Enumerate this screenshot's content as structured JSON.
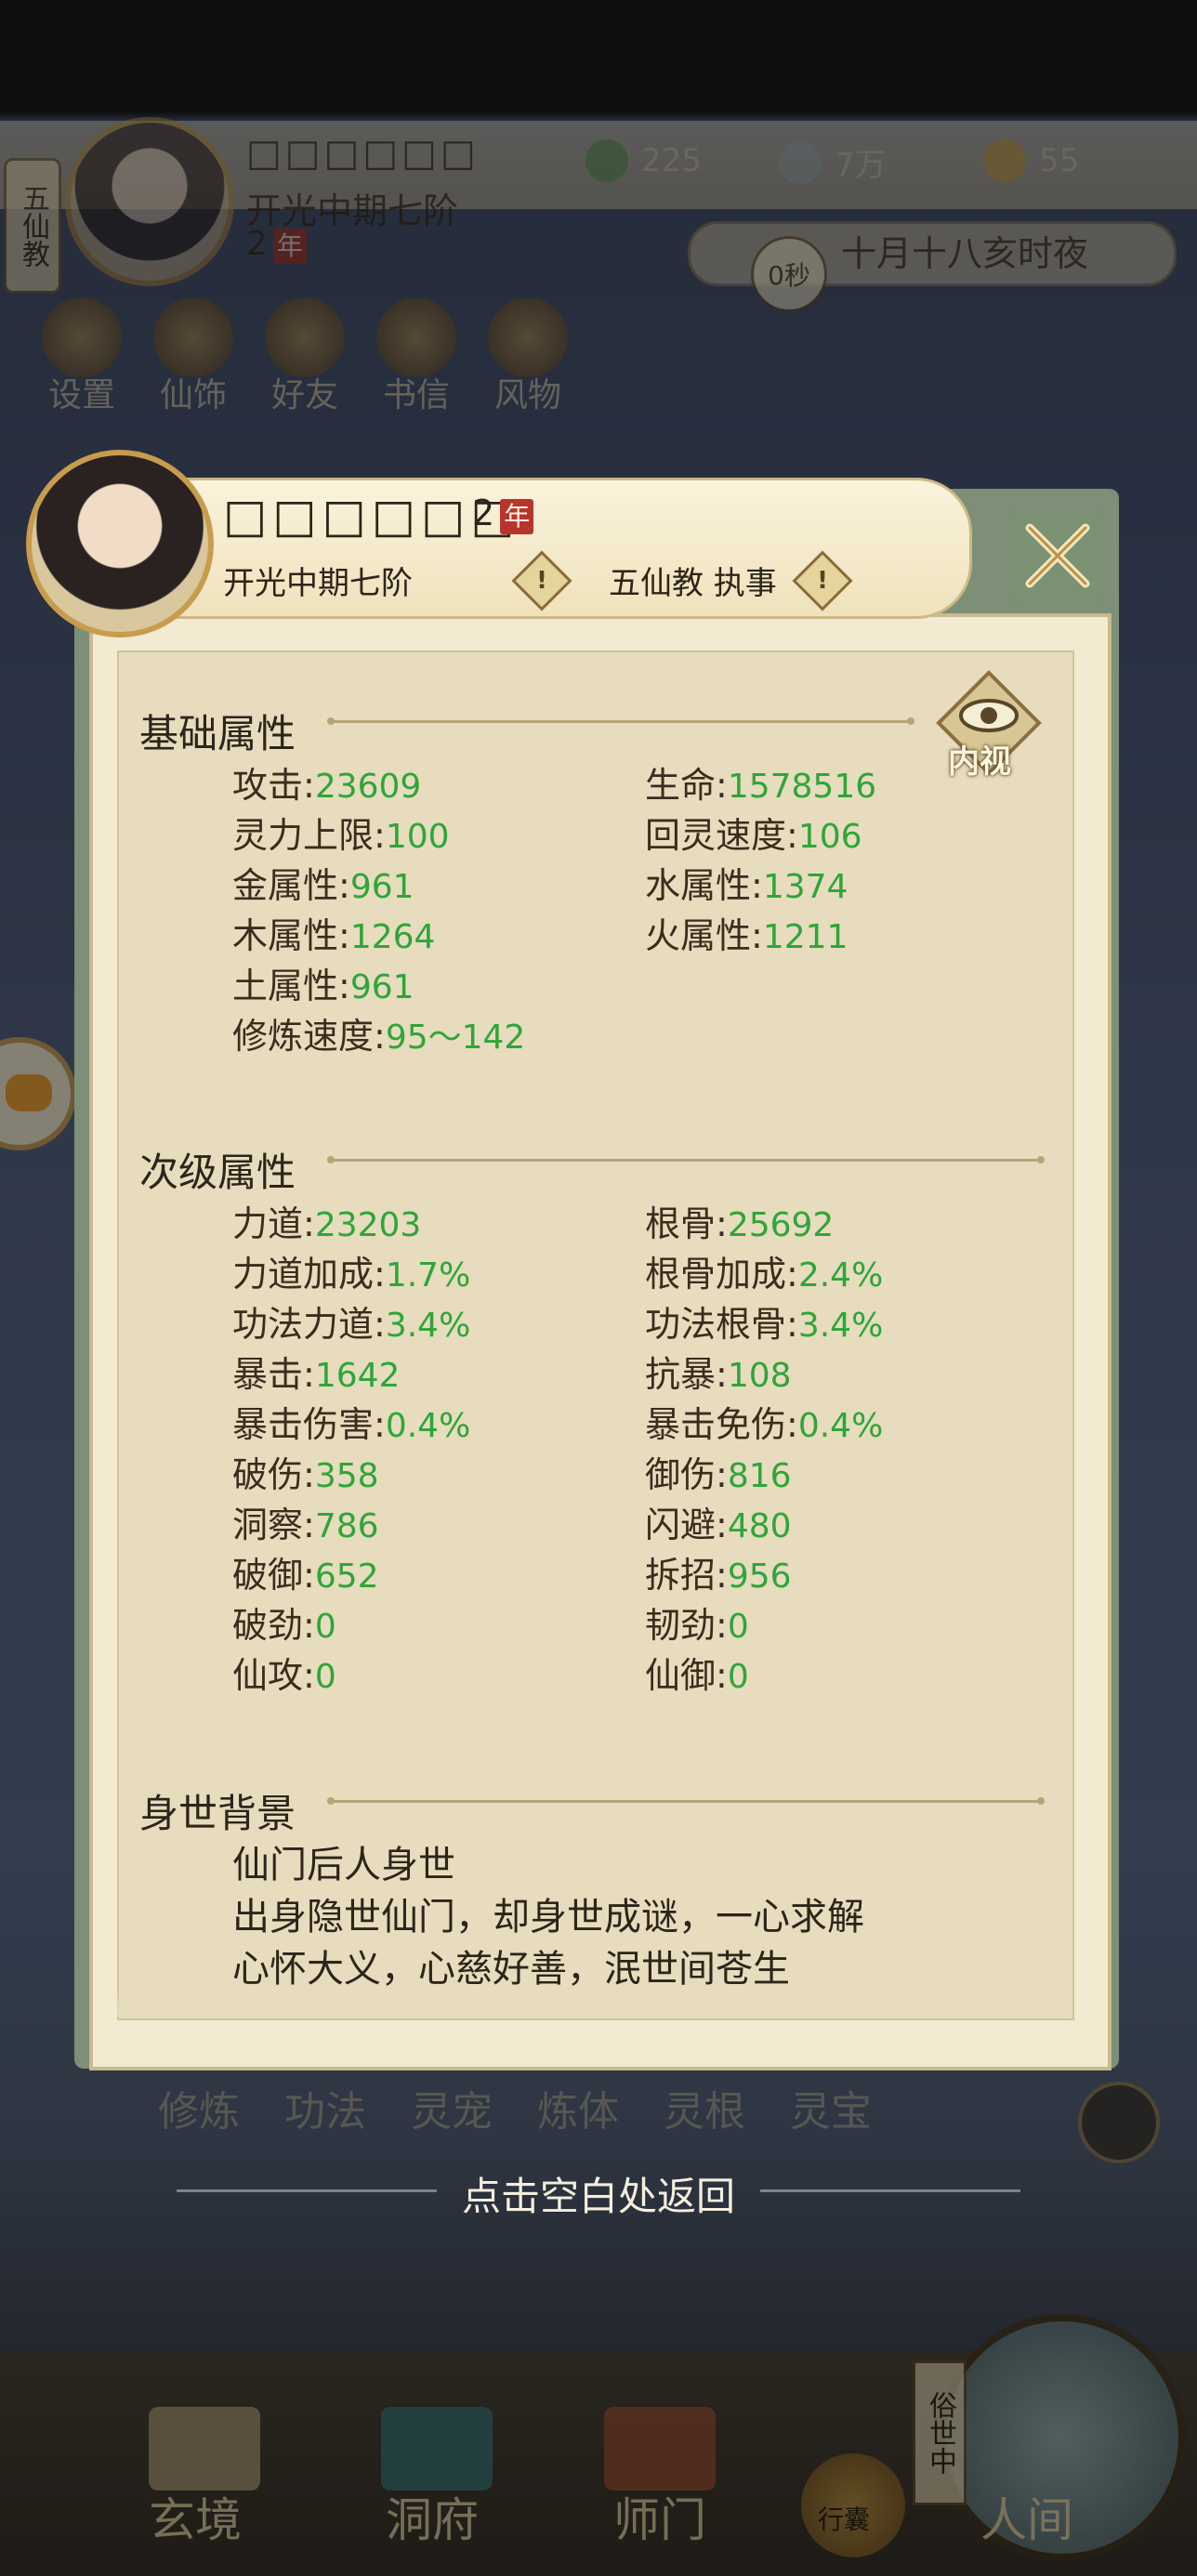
{
  "hud": {
    "sect_tag": "五仙教",
    "player_name": "□□□□□□",
    "realm": "开光中期七阶",
    "age": "2",
    "age_unit": "年",
    "resources": [
      {
        "icon": "spirit-leaf-icon",
        "value": "225"
      },
      {
        "icon": "coin-icon",
        "value": "7万"
      },
      {
        "icon": "gold-ingot-icon",
        "value": "55"
      }
    ],
    "timer_seconds": "0秒",
    "game_time": "十月十八亥时夜",
    "menu": [
      "设置",
      "仙饰",
      "好友",
      "书信",
      "风物"
    ]
  },
  "panel": {
    "name": "□□□□□□",
    "age": "2",
    "age_unit": "年",
    "realm": "开光中期七阶",
    "sect_position": "五仙教 执事",
    "info_mark": "!",
    "inner_view_label": "内视",
    "basic": {
      "title": "基础属性",
      "left": [
        {
          "label": "攻击:",
          "value": "23609"
        },
        {
          "label": "灵力上限:",
          "value": "100"
        },
        {
          "label": "金属性:",
          "value": "961"
        },
        {
          "label": "木属性:",
          "value": "1264"
        },
        {
          "label": "土属性:",
          "value": "961"
        },
        {
          "label": "修炼速度:",
          "value": "95～142"
        }
      ],
      "right": [
        {
          "label": "生命:",
          "value": "1578516"
        },
        {
          "label": "回灵速度:",
          "value": "106"
        },
        {
          "label": "水属性:",
          "value": "1374"
        },
        {
          "label": "火属性:",
          "value": "1211"
        }
      ]
    },
    "secondary": {
      "title": "次级属性",
      "left": [
        {
          "label": "力道:",
          "value": "23203"
        },
        {
          "label": "力道加成:",
          "value": "1.7%"
        },
        {
          "label": "功法力道:",
          "value": "3.4%"
        },
        {
          "label": "暴击:",
          "value": "1642"
        },
        {
          "label": "暴击伤害:",
          "value": "0.4%"
        },
        {
          "label": "破伤:",
          "value": "358"
        },
        {
          "label": "洞察:",
          "value": "786"
        },
        {
          "label": "破御:",
          "value": "652"
        },
        {
          "label": "破劲:",
          "value": "0"
        },
        {
          "label": "仙攻:",
          "value": "0"
        }
      ],
      "right": [
        {
          "label": "根骨:",
          "value": "25692"
        },
        {
          "label": "根骨加成:",
          "value": "2.4%"
        },
        {
          "label": "功法根骨:",
          "value": "3.4%"
        },
        {
          "label": "抗暴:",
          "value": "108"
        },
        {
          "label": "暴击免伤:",
          "value": "0.4%"
        },
        {
          "label": "御伤:",
          "value": "816"
        },
        {
          "label": "闪避:",
          "value": "480"
        },
        {
          "label": "拆招:",
          "value": "956"
        },
        {
          "label": "韧劲:",
          "value": "0"
        },
        {
          "label": "仙御:",
          "value": "0"
        }
      ]
    },
    "background": {
      "title": "身世背景",
      "lines": [
        "仙门后人身世",
        "出身隐世仙门，却身世成谜，一心求解",
        "心怀大义，心慈好善，泯世间苍生"
      ]
    }
  },
  "bottom_tabs": [
    "修炼",
    "功法",
    "灵宠",
    "炼体",
    "灵根",
    "灵宝"
  ],
  "return_hint": "点击空白处返回",
  "nav": {
    "items": [
      "玄境",
      "洞府",
      "师门"
    ],
    "bag_label": "行囊",
    "world_label": "人间",
    "world_tag": "俗世中"
  },
  "colors": {
    "value_green": "#2fa53a",
    "panel_frame": "#7d8f77",
    "seal_red": "#b8352c"
  }
}
